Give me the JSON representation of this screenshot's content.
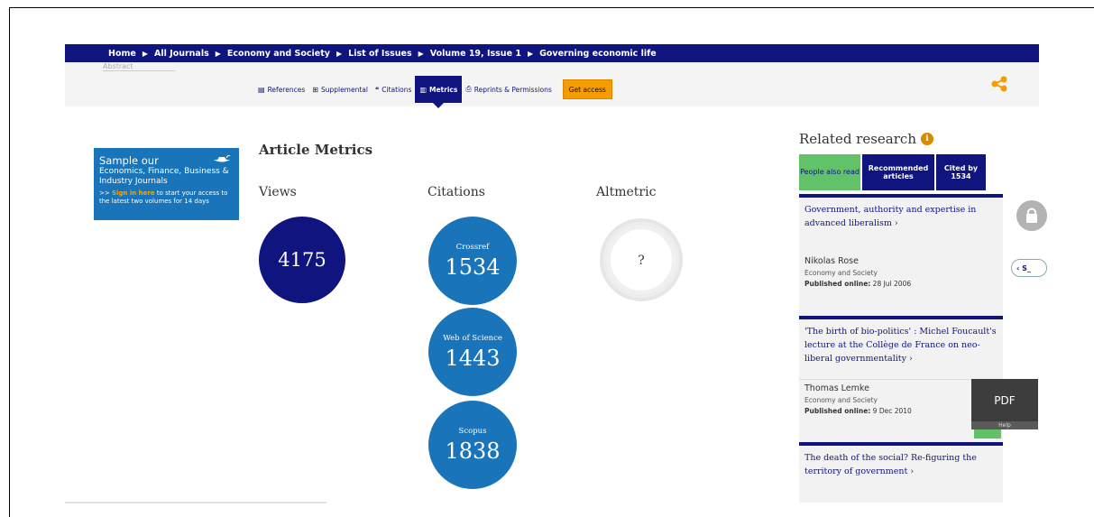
{
  "breadcrumb": {
    "items": [
      "Home",
      "All Journals",
      "Economy and Society",
      "List of Issues",
      "Volume 19, Issue 1",
      "Governing economic life"
    ],
    "separator": "▶"
  },
  "top_faded": "Abstract",
  "tabs": [
    {
      "label": "References",
      "icon": "document-icon"
    },
    {
      "label": "Supplemental",
      "icon": "plus-box-icon"
    },
    {
      "label": "Citations",
      "icon": "quote-icon"
    },
    {
      "label": "Metrics",
      "icon": "bar-chart-icon",
      "active": true
    },
    {
      "label": "Reprints & Permissions",
      "icon": "printer-icon"
    }
  ],
  "get_access": "Get access",
  "promo": {
    "line1": "Sample our",
    "line2": "Economics, Finance, Business & Industry Journals",
    "line3_prefix": ">> ",
    "line3_link": "Sign in here",
    "line3_rest": " to start your access to the latest two volumes for 14 days"
  },
  "metrics": {
    "title": "Article Metrics",
    "views_label": "Views",
    "views_value": "4175",
    "citations_label": "Citations",
    "altmetric_label": "Altmetric",
    "altmetric_value": "?",
    "citations": [
      {
        "source": "Crossref",
        "value": "1534"
      },
      {
        "source": "Web of Science",
        "value": "1443"
      },
      {
        "source": "Scopus",
        "value": "1838"
      }
    ]
  },
  "related": {
    "title": "Related research",
    "tabs": [
      {
        "label": "People also read",
        "active": true
      },
      {
        "label": "Recommended articles"
      },
      {
        "label": "Cited by 1534"
      }
    ],
    "articles": [
      {
        "title": "Government, authority and expertise in advanced liberalism",
        "author": "Nikolas Rose",
        "journal": "Economy and Society",
        "published_label": "Published online:",
        "published_date": "28 Jul 2006"
      },
      {
        "title": "'The birth of bio-politics' : Michel Foucault's lecture at the Collège de France on neo-liberal governmentality",
        "author": "Thomas Lemke",
        "journal": "Economy and Society",
        "published_label": "Published online:",
        "published_date": "9 Dec 2010"
      },
      {
        "title": "The death of the social? Re-figuring the territory of government"
      }
    ]
  },
  "widgets": {
    "s_button": "‹ S_",
    "pdf_label": "PDF",
    "help_label": "Help"
  },
  "colors": {
    "navy": "#10147e",
    "blue": "#1a74b9",
    "orange": "#f59c00",
    "green": "#62c26a"
  }
}
